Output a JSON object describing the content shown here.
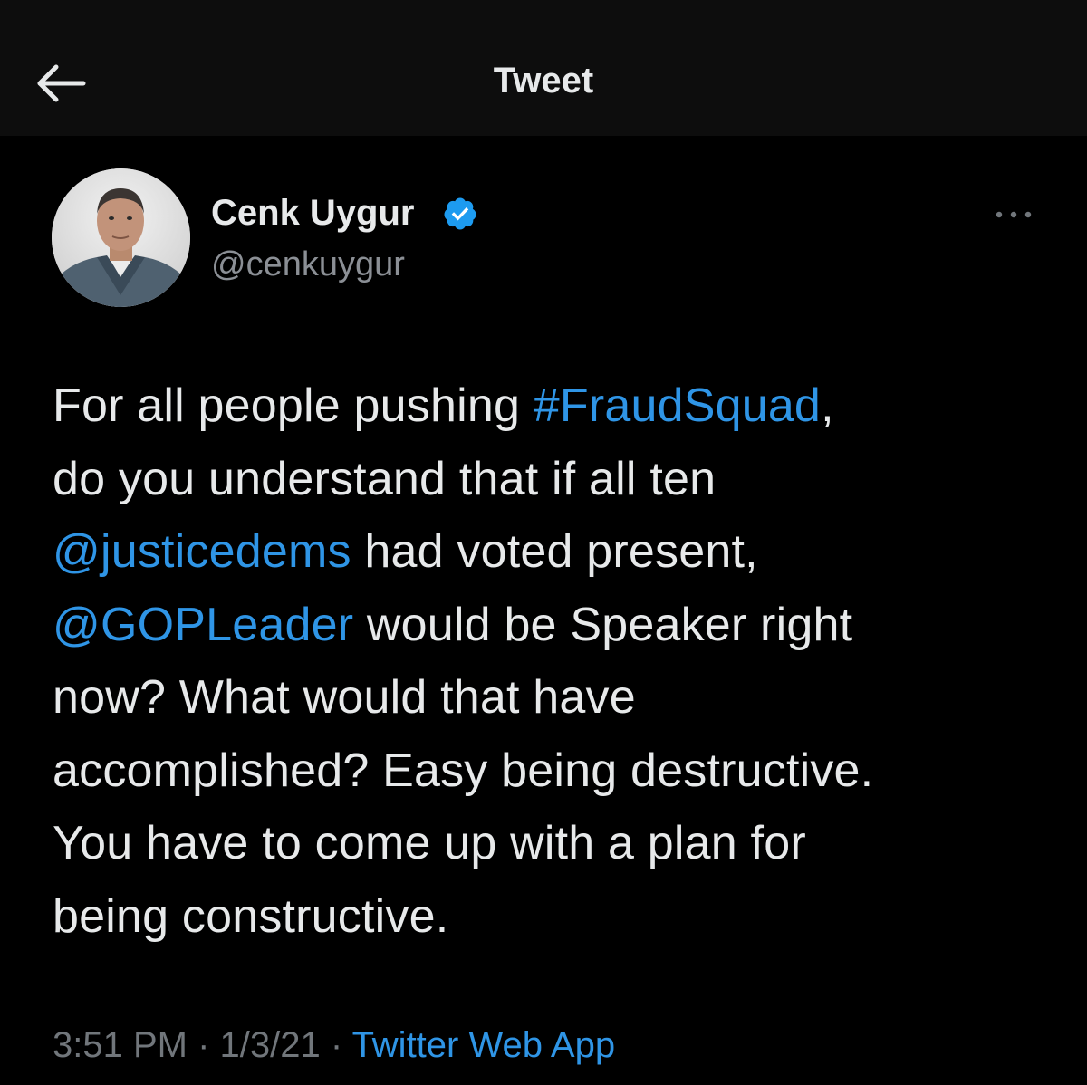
{
  "header": {
    "title": "Tweet",
    "back_icon": "arrow-left-icon"
  },
  "author": {
    "name": "Cenk Uygur",
    "handle": "@cenkuygur",
    "verified": true,
    "avatar_icon": "user-avatar"
  },
  "more_icon": "more-horizontal-icon",
  "tweet": {
    "lines": [
      [
        {
          "text": "For all people pushing ",
          "type": "text"
        },
        {
          "text": "#FraudSquad",
          "type": "hashtag"
        },
        {
          "text": ",",
          "type": "text"
        }
      ],
      [
        {
          "text": "do you understand that if all ten",
          "type": "text"
        }
      ],
      [
        {
          "text": "@justicedems",
          "type": "mention"
        },
        {
          "text": " had voted present,",
          "type": "text"
        }
      ],
      [
        {
          "text": "@GOPLeader",
          "type": "mention"
        },
        {
          "text": " would be Speaker right",
          "type": "text"
        }
      ],
      [
        {
          "text": "now? What would that have",
          "type": "text"
        }
      ],
      [
        {
          "text": "accomplished? Easy being destructive.",
          "type": "text"
        }
      ],
      [
        {
          "text": "You have to come up with a plan for",
          "type": "text"
        }
      ],
      [
        {
          "text": "being constructive.",
          "type": "text"
        }
      ]
    ]
  },
  "meta": {
    "time": "3:51 PM",
    "separator": " · ",
    "date": "1/3/21",
    "source": "Twitter Web App"
  },
  "colors": {
    "background": "#000000",
    "header_background": "#0d0d0d",
    "text": "#e7e9ea",
    "secondary_text": "#71767b",
    "link": "#2f95e6",
    "verified_badge": "#1d9bf0"
  }
}
